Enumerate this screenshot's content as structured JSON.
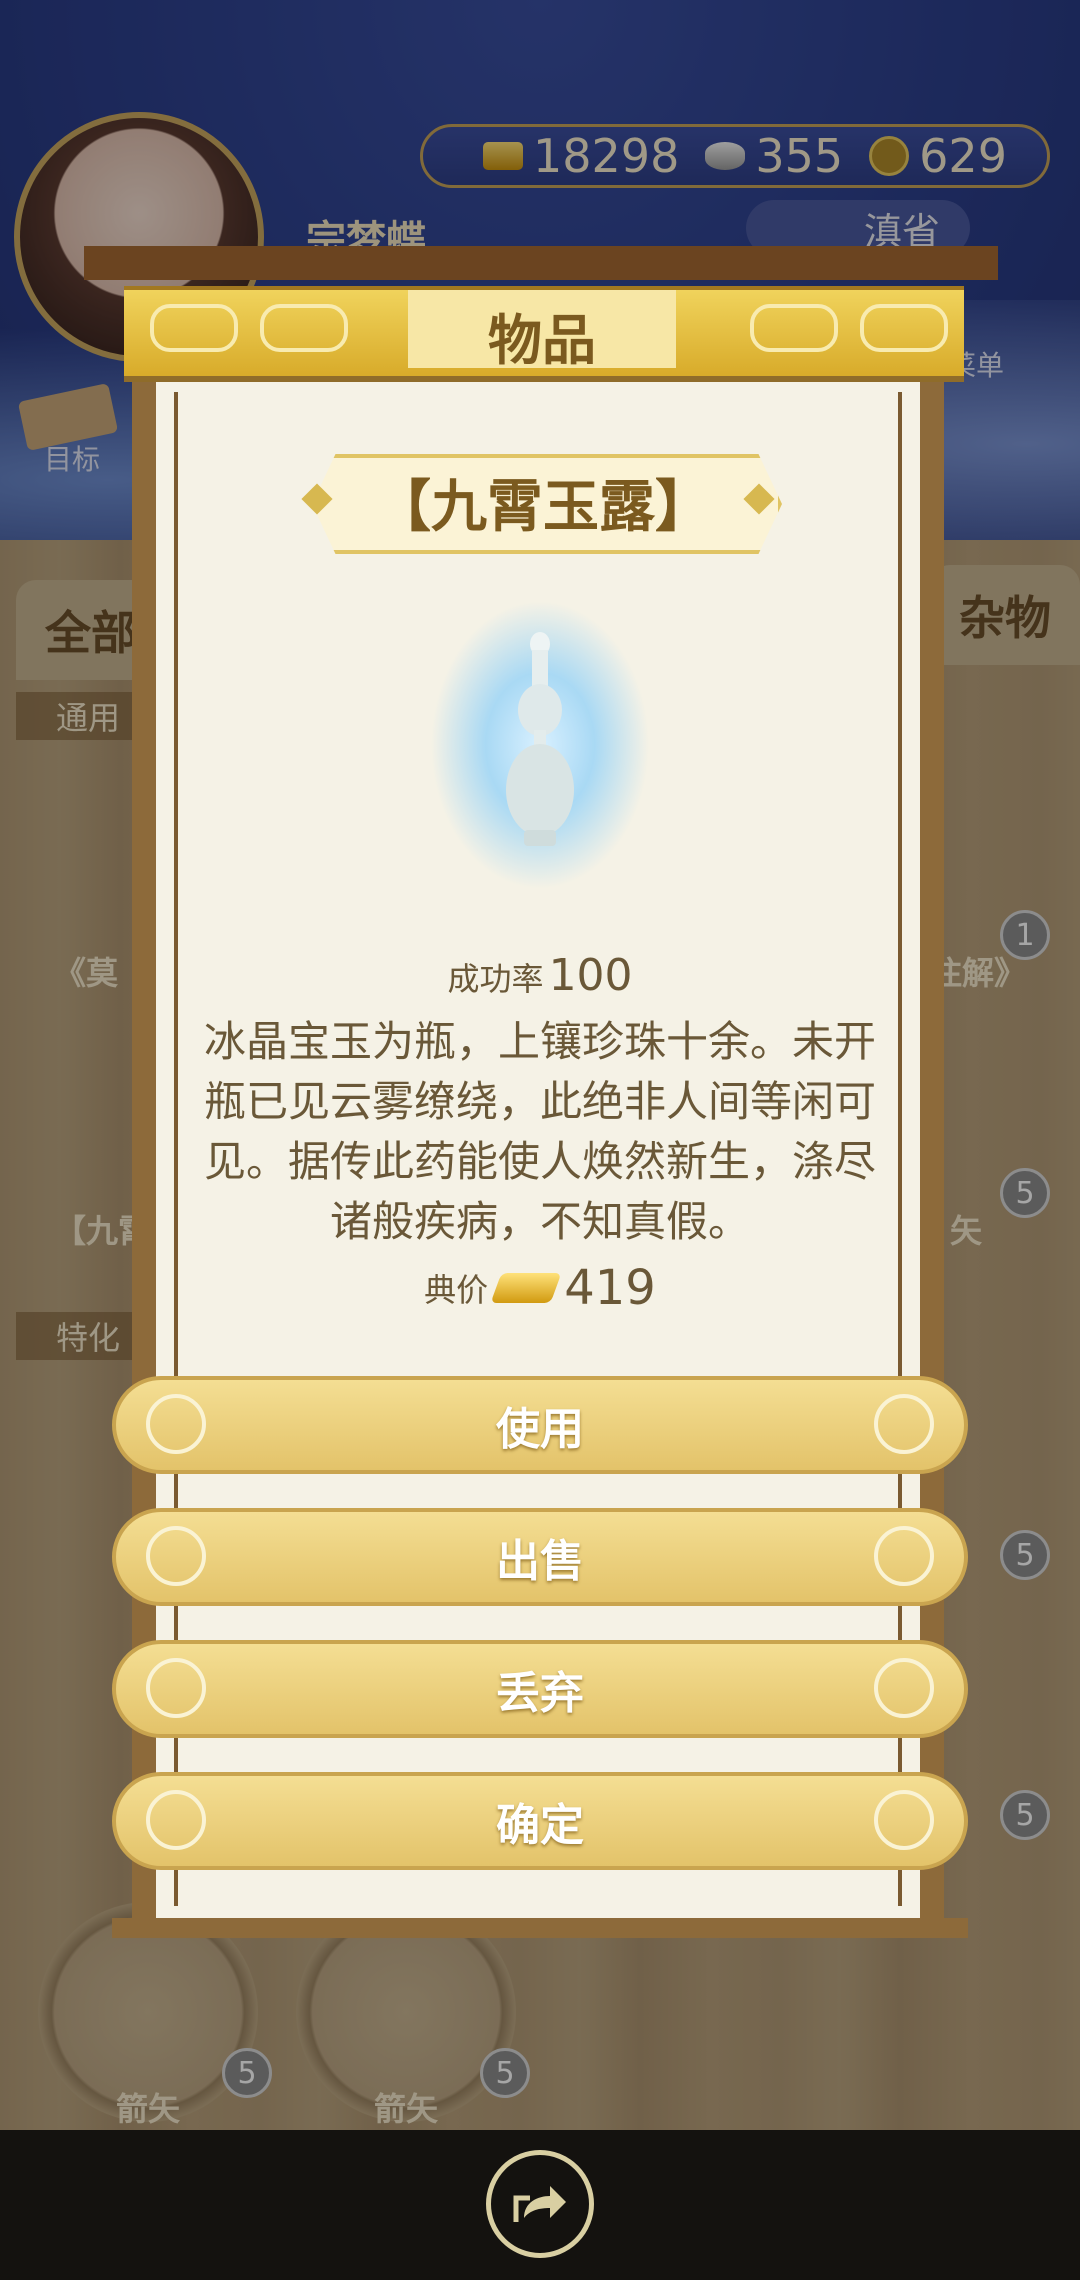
{
  "player": {
    "name": "宗梦蝶",
    "location": "滇省"
  },
  "currency": {
    "gold": "18298",
    "silver": "355",
    "coin": "629"
  },
  "hud": {
    "menu_label": "菜单",
    "goal_label": "目标"
  },
  "background": {
    "tab_all": "全部",
    "tab_misc": "杂物",
    "section_general": "通用",
    "section_special": "特化",
    "item_book": "《莫",
    "item_book_right": "注解》",
    "item_vial": "【九霄",
    "item_arrow_right": "矢",
    "arrow_label": "箭矢",
    "badge_1": "1",
    "badge_5": "5"
  },
  "modal": {
    "title": "物品",
    "item_name": "【九霄玉露】",
    "success_label": "成功率",
    "success_value": "100",
    "description": "冰晶宝玉为瓶，上镶珍珠十余。未开瓶已见云雾缭绕，此绝非人间等闲可见。据传此药能使人焕然新生，涤尽诸般疾病，不知真假。",
    "price_label": "典价",
    "price_value": "419",
    "buttons": {
      "use": "使用",
      "sell": "出售",
      "discard": "丢弃",
      "confirm": "确定"
    }
  },
  "footer": {
    "share_icon": "share-icon"
  },
  "colors": {
    "accent_gold": "#e3c36a",
    "text_brown": "#6a5838",
    "title_brown": "#7b5a1f"
  }
}
